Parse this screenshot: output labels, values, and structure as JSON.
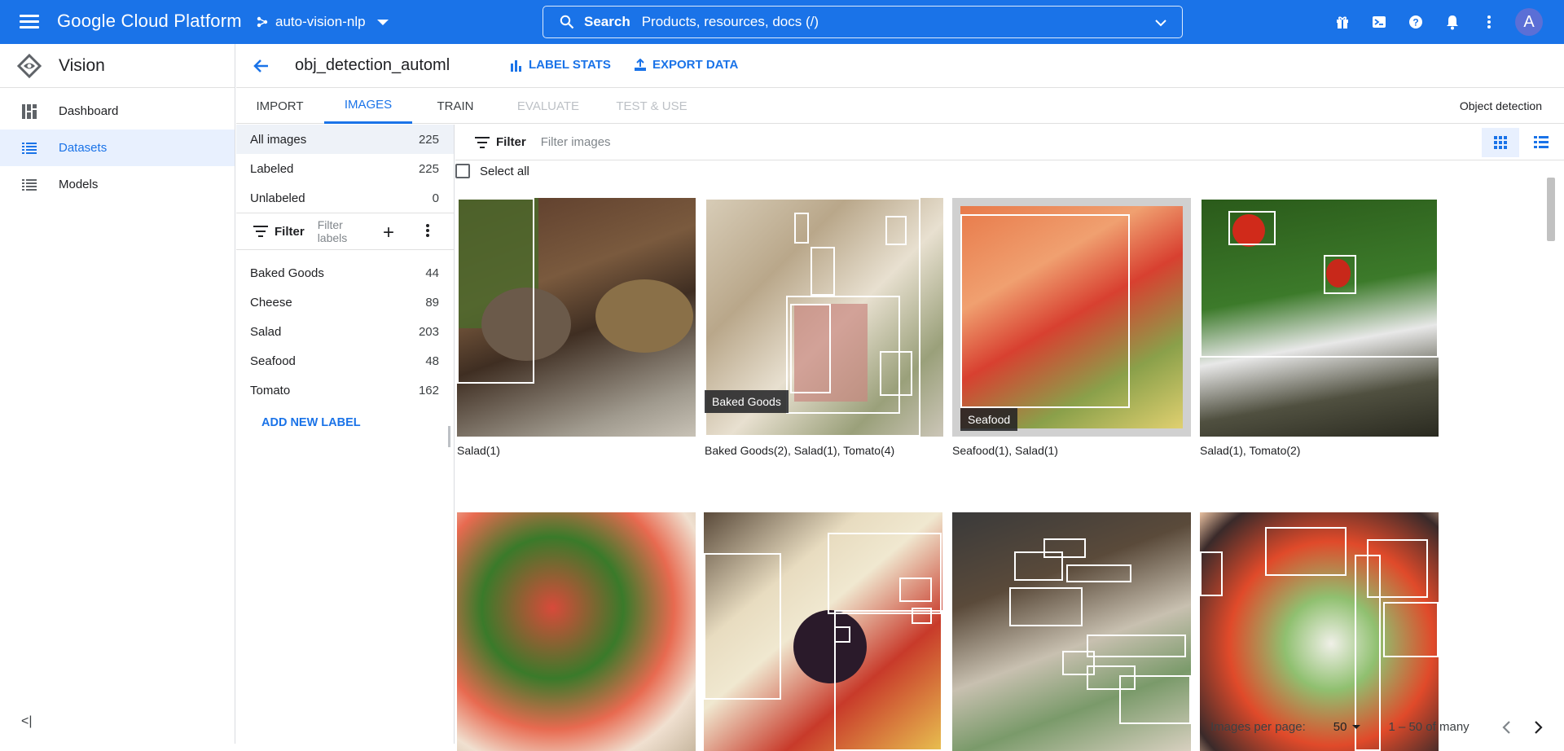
{
  "topbar": {
    "brand": "Google Cloud Platform",
    "project": "auto-vision-nlp",
    "search_label": "Search",
    "search_placeholder": "Products, resources, docs (/)",
    "avatar_letter": "A",
    "brand_color": "#1a73e8"
  },
  "nav": {
    "product": "Vision",
    "items": [
      {
        "label": "Dashboard",
        "icon": "dashboard-icon"
      },
      {
        "label": "Datasets",
        "icon": "list-icon"
      },
      {
        "label": "Models",
        "icon": "list-icon"
      }
    ],
    "collapse_glyph": "<|"
  },
  "header": {
    "dataset_name": "obj_detection_automl",
    "label_stats": "LABEL STATS",
    "export_data": "EXPORT DATA"
  },
  "tabs": [
    {
      "label": "IMPORT",
      "state": "normal"
    },
    {
      "label": "IMAGES",
      "state": "active"
    },
    {
      "label": "TRAIN",
      "state": "normal"
    },
    {
      "label": "EVALUATE",
      "state": "disabled"
    },
    {
      "label": "TEST & USE",
      "state": "disabled"
    }
  ],
  "model_type": "Object detection",
  "left_panel": {
    "filters": [
      {
        "label": "All images",
        "count": "225"
      },
      {
        "label": "Labeled",
        "count": "225"
      },
      {
        "label": "Unlabeled",
        "count": "0"
      }
    ],
    "filter_label": "Filter",
    "filter_placeholder": "Filter labels",
    "labels": [
      {
        "label": "Baked Goods",
        "count": "44"
      },
      {
        "label": "Cheese",
        "count": "89"
      },
      {
        "label": "Salad",
        "count": "203"
      },
      {
        "label": "Seafood",
        "count": "48"
      },
      {
        "label": "Tomato",
        "count": "162"
      }
    ],
    "add_label": "ADD NEW LABEL"
  },
  "main": {
    "filter_label": "Filter",
    "filter_placeholder": "Filter images",
    "select_all": "Select all",
    "images": [
      {
        "caption": "Salad(1)",
        "tag": ""
      },
      {
        "caption": "Baked Goods(2), Salad(1), Tomato(4)",
        "tag": "Baked Goods"
      },
      {
        "caption": "Seafood(1), Salad(1)",
        "tag": "Seafood"
      },
      {
        "caption": "Salad(1), Tomato(2)",
        "tag": ""
      },
      {
        "caption": "",
        "tag": ""
      },
      {
        "caption": "",
        "tag": ""
      },
      {
        "caption": "",
        "tag": ""
      },
      {
        "caption": "",
        "tag": ""
      }
    ]
  },
  "pager": {
    "images_per_page_label": "Images per page:",
    "per_page": "50",
    "range": "1 – 50 of many"
  }
}
